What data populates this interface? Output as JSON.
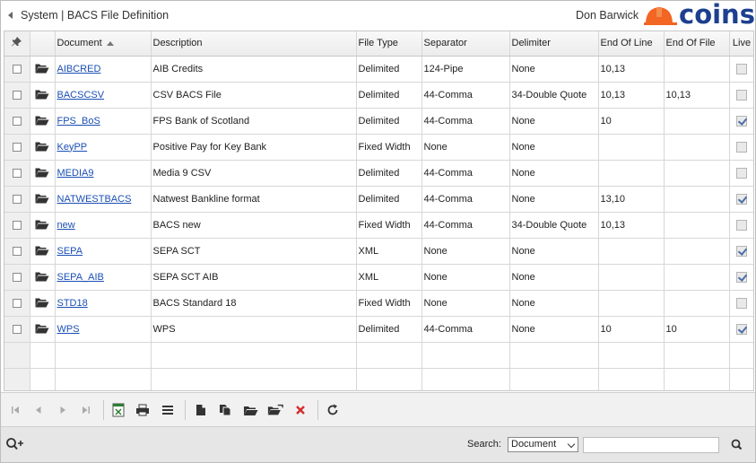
{
  "header": {
    "breadcrumb": "System | BACS File Definition",
    "user": "Don Barwick",
    "logo_text": "coins",
    "brand_color": "#1d3f8f",
    "logo_accent": "#f26522"
  },
  "grid": {
    "columns": {
      "document": "Document",
      "description": "Description",
      "file_type": "File Type",
      "separator": "Separator",
      "delimiter": "Delimiter",
      "end_of_line": "End Of Line",
      "end_of_file": "End Of File",
      "live": "Live"
    },
    "sort": {
      "column": "document",
      "direction": "ascending"
    },
    "rows": [
      {
        "document": "AIBCRED",
        "description": "AIB Credits",
        "file_type": "Delimited",
        "separator": "124-Pipe",
        "delimiter": "None",
        "end_of_line": "10,13",
        "end_of_file": "",
        "live": false
      },
      {
        "document": "BACSCSV",
        "description": "CSV BACS File",
        "file_type": "Delimited",
        "separator": "44-Comma",
        "delimiter": "34-Double Quote",
        "end_of_line": "10,13",
        "end_of_file": "10,13",
        "live": false
      },
      {
        "document": "FPS_BoS",
        "description": "FPS Bank of Scotland",
        "file_type": "Delimited",
        "separator": "44-Comma",
        "delimiter": "None",
        "end_of_line": "10",
        "end_of_file": "",
        "live": true
      },
      {
        "document": "KeyPP",
        "description": "Positive Pay for Key Bank",
        "file_type": "Fixed Width",
        "separator": "None",
        "delimiter": "None",
        "end_of_line": "",
        "end_of_file": "",
        "live": false
      },
      {
        "document": "MEDIA9",
        "description": "Media 9 CSV",
        "file_type": "Delimited",
        "separator": "44-Comma",
        "delimiter": "None",
        "end_of_line": "",
        "end_of_file": "",
        "live": false
      },
      {
        "document": "NATWESTBACS",
        "description": "Natwest Bankline format",
        "file_type": "Delimited",
        "separator": "44-Comma",
        "delimiter": "None",
        "end_of_line": "13,10",
        "end_of_file": "",
        "live": true
      },
      {
        "document": "new",
        "description": "BACS new",
        "file_type": "Fixed Width",
        "separator": "44-Comma",
        "delimiter": "34-Double Quote",
        "end_of_line": "10,13",
        "end_of_file": "",
        "live": false
      },
      {
        "document": "SEPA",
        "description": "SEPA SCT",
        "file_type": "XML",
        "separator": "None",
        "delimiter": "None",
        "end_of_line": "",
        "end_of_file": "",
        "live": true
      },
      {
        "document": "SEPA_AIB",
        "description": "SEPA SCT AIB",
        "file_type": "XML",
        "separator": "None",
        "delimiter": "None",
        "end_of_line": "",
        "end_of_file": "",
        "live": true
      },
      {
        "document": "STD18",
        "description": "BACS Standard 18",
        "file_type": "Fixed Width",
        "separator": "None",
        "delimiter": "None",
        "end_of_line": "",
        "end_of_file": "",
        "live": false
      },
      {
        "document": "WPS",
        "description": "WPS",
        "file_type": "Delimited",
        "separator": "44-Comma",
        "delimiter": "None",
        "end_of_line": "10",
        "end_of_file": "10",
        "live": true
      }
    ]
  },
  "toolbar": {
    "icons": [
      "first-page-icon",
      "previous-page-icon",
      "next-page-icon",
      "last-page-icon",
      "export-excel-icon",
      "print-icon",
      "list-view-icon",
      "new-document-icon",
      "copy-document-icon",
      "open-folder-icon",
      "open-record-icon",
      "delete-icon",
      "refresh-icon"
    ],
    "delete_color": "#d32f2f"
  },
  "search": {
    "label": "Search:",
    "field": "Document",
    "value": ""
  }
}
